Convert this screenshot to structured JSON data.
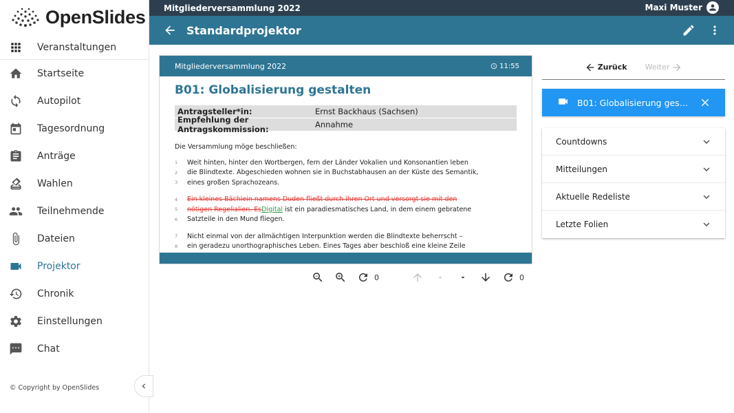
{
  "app": {
    "logo_text": "OpenSlides",
    "copyright": "© Copyright by OpenSlides"
  },
  "sidebar": {
    "events_label": "Veranstaltungen",
    "items": [
      {
        "label": "Startseite",
        "icon": "home-icon"
      },
      {
        "label": "Autopilot",
        "icon": "autopilot-icon"
      },
      {
        "label": "Tagesordnung",
        "icon": "calendar-icon"
      },
      {
        "label": "Anträge",
        "icon": "clipboard-icon"
      },
      {
        "label": "Wahlen",
        "icon": "ballot-icon"
      },
      {
        "label": "Teilnehmende",
        "icon": "people-icon"
      },
      {
        "label": "Dateien",
        "icon": "paperclip-icon"
      },
      {
        "label": "Projektor",
        "icon": "videocam-icon",
        "active": true
      },
      {
        "label": "Chronik",
        "icon": "history-icon"
      },
      {
        "label": "Einstellungen",
        "icon": "gear-icon"
      },
      {
        "label": "Chat",
        "icon": "chat-icon"
      }
    ]
  },
  "topbar": {
    "meeting": "Mitgliederversammlung 2022",
    "user": "Maxi Muster"
  },
  "header": {
    "title": "Standardprojektor"
  },
  "projector": {
    "head_title": "Mitgliederversammlung 2022",
    "clock": "11:55",
    "slide_title": "B01: Globalisierung gestalten",
    "meta": [
      {
        "label": "Antragsteller*in:",
        "value": "Ernst Backhaus (Sachsen)"
      },
      {
        "label": "Empfehlung der Antragskommission:",
        "value": "Annahme"
      }
    ],
    "intro": "Die Versammlung möge beschließen:",
    "lines": {
      "l1": {
        "num": "1",
        "text": "Weit hinten, hinter den Wortbergen, fern der Länder Vokalien und Konsonantien leben"
      },
      "l2": {
        "num": "2",
        "text": "die Blindtexte. Abgeschieden wohnen sie in Buchstabhausen an der Küste des Semantik,"
      },
      "l3": {
        "num": "3",
        "text": "eines großen Sprachozeans."
      },
      "l4": {
        "num": "4",
        "deleted": "Ein kleines Bächlein namens Duden fließt durch ihren Ort und versorgt sie mit den"
      },
      "l5": {
        "num": "5",
        "deleted": "nötigen Regelialien. Es",
        "inserted": "Digital",
        "text": " ist ein paradiesmatisches Land, in dem einem gebratene"
      },
      "l6": {
        "num": "6",
        "text": "Satzteile in den Mund fliegen."
      },
      "l7": {
        "num": "7",
        "text": "Nicht einmal von der allmächtigen Interpunktion werden die Blindtexte beherrscht –"
      },
      "l8": {
        "num": "8",
        "text": "ein geradezu unorthographisches Leben. Eines Tages aber beschloß eine kleine Zeile"
      }
    }
  },
  "controls": {
    "refresh_count_1": "0",
    "refresh_count_2": "0"
  },
  "right": {
    "prev_label": "Zurück",
    "next_label": "Weiter",
    "current_slide": "B01: Globalisierung gestalten",
    "panels": [
      "Countdowns",
      "Mitteilungen",
      "Aktuelle Redeliste",
      "Letzte Folien"
    ]
  },
  "colors": {
    "primary": "#2e7594",
    "topbar": "#2d3f4f",
    "accent": "#2196f3",
    "deleted": "#e53935",
    "inserted": "#2e9a44"
  }
}
